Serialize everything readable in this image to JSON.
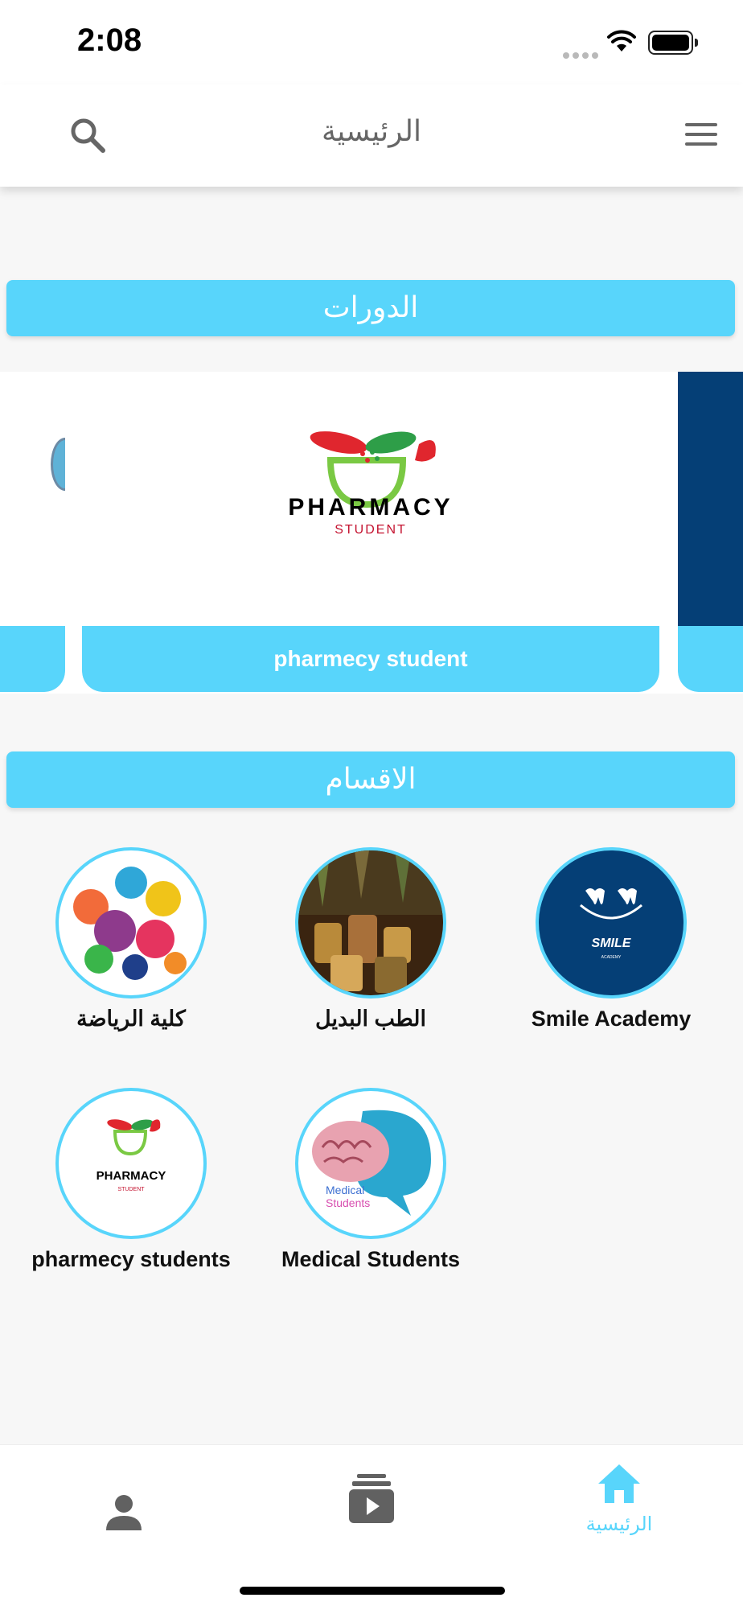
{
  "status": {
    "time": "2:08"
  },
  "header": {
    "title": "الرئيسية"
  },
  "sections": {
    "courses_title": "الدورات",
    "categories_title": "الاقسام"
  },
  "courses": [
    {
      "name": "pharmecy student",
      "logo_word": "PHARMACY",
      "logo_sub": "STUDENT"
    }
  ],
  "categories": [
    {
      "name": "Smile Academy",
      "logo_word": "SMILE",
      "logo_sub": "ACADEMY"
    },
    {
      "name": "الطب البديل"
    },
    {
      "name": "كلية الرياضة"
    },
    {
      "name": "Medical Students",
      "logo_word1": "Medical",
      "logo_word2": "Students"
    },
    {
      "name": "pharmecy students",
      "logo_word": "PHARMACY",
      "logo_sub": "STUDENT"
    }
  ],
  "bottom_nav": {
    "home_label": "الرئيسية",
    "active": "home"
  },
  "colors": {
    "accent": "#58d5fb",
    "navy": "#053f76"
  }
}
